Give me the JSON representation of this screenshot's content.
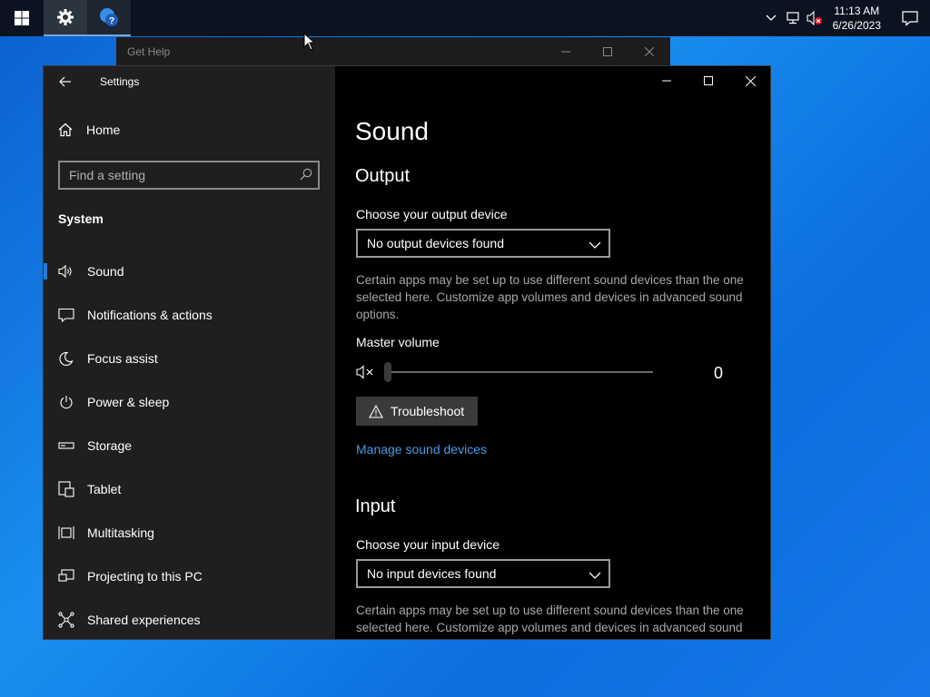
{
  "taskbar": {
    "clock_time": "11:13 AM",
    "clock_date": "6/26/2023"
  },
  "gethelp_window": {
    "title": "Get Help"
  },
  "settings": {
    "app_title": "Settings",
    "home_label": "Home",
    "search_placeholder": "Find a setting",
    "section_title": "System",
    "nav_items": [
      {
        "label": "Sound",
        "icon": "speaker-icon",
        "selected": true
      },
      {
        "label": "Notifications & actions",
        "icon": "notification-icon"
      },
      {
        "label": "Focus assist",
        "icon": "moon-icon"
      },
      {
        "label": "Power & sleep",
        "icon": "power-icon"
      },
      {
        "label": "Storage",
        "icon": "storage-icon"
      },
      {
        "label": "Tablet",
        "icon": "tablet-icon"
      },
      {
        "label": "Multitasking",
        "icon": "multitasking-icon"
      },
      {
        "label": "Projecting to this PC",
        "icon": "projecting-icon"
      },
      {
        "label": "Shared experiences",
        "icon": "shared-experiences-icon"
      }
    ]
  },
  "sound": {
    "page_title": "Sound",
    "output_heading": "Output",
    "output_device_label": "Choose your output device",
    "output_device_value": "No output devices found",
    "output_desc": "Certain apps may be set up to use different sound devices than the one selected here. Customize app volumes and devices in advanced sound options.",
    "master_volume_label": "Master volume",
    "master_volume_value": "0",
    "troubleshoot_label": "Troubleshoot",
    "manage_link": "Manage sound devices",
    "input_heading": "Input",
    "input_device_label": "Choose your input device",
    "input_device_value": "No input devices found",
    "input_desc": "Certain apps may be set up to use different sound devices than the one selected here. Customize app volumes and devices in advanced sound options."
  },
  "colors": {
    "accent": "#2a7ad6",
    "link": "#4a9be8",
    "sidebar_bg": "#1f1f1f",
    "content_bg": "#000000"
  }
}
